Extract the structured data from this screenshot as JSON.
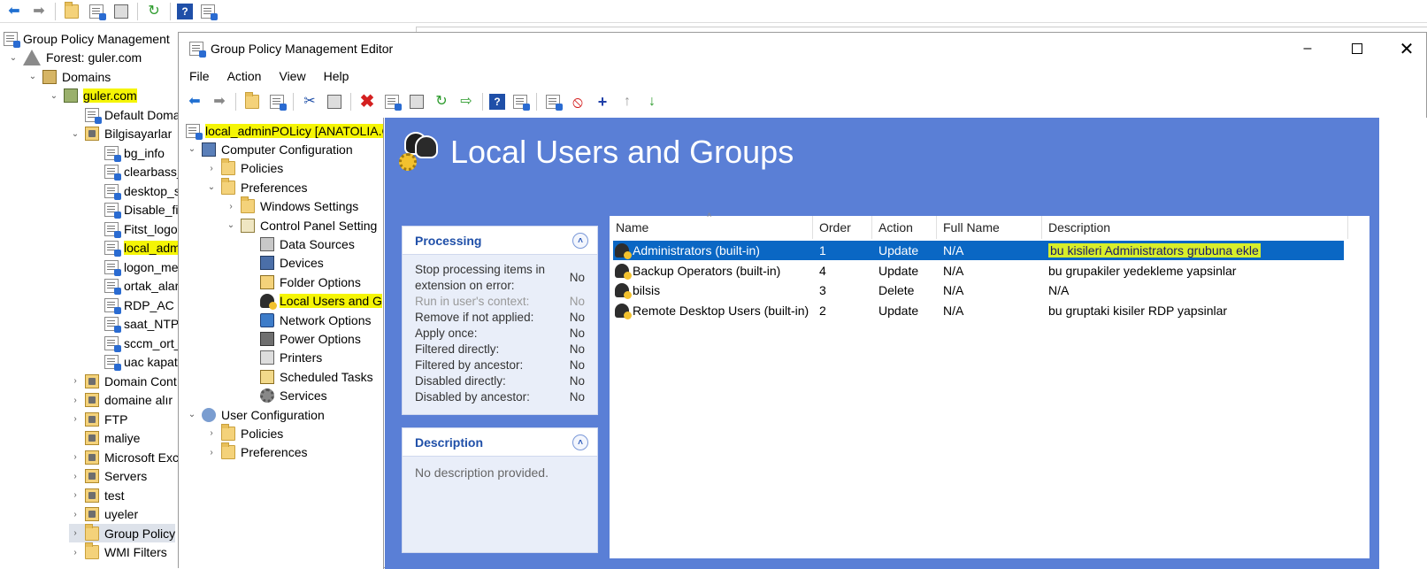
{
  "outer": {
    "tree": [
      {
        "label": "Group Policy Management",
        "icon": "gpm-icon",
        "indent": 0
      },
      {
        "label": "Forest: guler.com",
        "icon": "forest-icon",
        "indent": 1
      },
      {
        "label": "Domains",
        "icon": "domains-icon",
        "indent": 2
      },
      {
        "label": "guler.com",
        "icon": "domain-icon",
        "indent": 3
      },
      {
        "label": "Default Doma",
        "icon": "gpo-icon",
        "indent": 4
      },
      {
        "label": "Bilgisayarlar",
        "icon": "ou-icon",
        "indent": 4
      },
      {
        "label": "bg_info",
        "icon": "gpo-icon",
        "indent": 5
      },
      {
        "label": "clearbass_",
        "icon": "gpo-icon",
        "indent": 5
      },
      {
        "label": "desktop_s",
        "icon": "gpo-icon",
        "indent": 5
      },
      {
        "label": "Disable_fi",
        "icon": "gpo-icon",
        "indent": 5
      },
      {
        "label": "Fitst_logo",
        "icon": "gpo-icon",
        "indent": 5
      },
      {
        "label": "local_adm",
        "icon": "gpo-icon",
        "indent": 5
      },
      {
        "label": "logon_me",
        "icon": "gpo-icon",
        "indent": 5
      },
      {
        "label": "ortak_alar",
        "icon": "gpo-icon",
        "indent": 5
      },
      {
        "label": "RDP_AC",
        "icon": "gpo-icon",
        "indent": 5
      },
      {
        "label": "saat_NTP",
        "icon": "gpo-icon",
        "indent": 5
      },
      {
        "label": "sccm_ort_",
        "icon": "gpo-icon",
        "indent": 5
      },
      {
        "label": "uac kapat",
        "icon": "gpo-icon",
        "indent": 5
      },
      {
        "label": "Domain Cont",
        "icon": "ou-icon",
        "indent": 4
      },
      {
        "label": "domaine alır",
        "icon": "ou-icon",
        "indent": 4
      },
      {
        "label": "FTP",
        "icon": "ou-icon",
        "indent": 4
      },
      {
        "label": "maliye",
        "icon": "ou-icon",
        "indent": 4
      },
      {
        "label": "Microsoft Exc",
        "icon": "ou-icon",
        "indent": 4
      },
      {
        "label": "Servers",
        "icon": "ou-icon",
        "indent": 4
      },
      {
        "label": "test",
        "icon": "ou-icon",
        "indent": 4
      },
      {
        "label": "uyeler",
        "icon": "ou-icon",
        "indent": 4
      },
      {
        "label": "Group Policy",
        "icon": "folder-icon",
        "indent": 4
      },
      {
        "label": "WMI Filters",
        "icon": "folder-icon",
        "indent": 4
      }
    ]
  },
  "editor": {
    "title": "Group Policy Management Editor",
    "menu": [
      "File",
      "Action",
      "View",
      "Help"
    ],
    "tree": [
      {
        "label": "local_adminPOLicy [ANATOLIA.GU",
        "icon": "gpo-icon"
      },
      {
        "label": "Computer Configuration",
        "icon": "computer-icon"
      },
      {
        "label": "Policies",
        "icon": "folder-icon"
      },
      {
        "label": "Preferences",
        "icon": "folder-icon"
      },
      {
        "label": "Windows Settings",
        "icon": "folder-icon"
      },
      {
        "label": "Control Panel Setting",
        "icon": "control-panel-icon"
      },
      {
        "label": "Data Sources",
        "icon": "data-sources-icon"
      },
      {
        "label": "Devices",
        "icon": "devices-icon"
      },
      {
        "label": "Folder Options",
        "icon": "folder-options-icon"
      },
      {
        "label": "Local Users and G",
        "icon": "local-users-icon"
      },
      {
        "label": "Network Options",
        "icon": "network-icon"
      },
      {
        "label": "Power Options",
        "icon": "power-icon"
      },
      {
        "label": "Printers",
        "icon": "printer-icon"
      },
      {
        "label": "Scheduled Tasks",
        "icon": "tasks-icon"
      },
      {
        "label": "Services",
        "icon": "services-icon"
      },
      {
        "label": "User Configuration",
        "icon": "user-icon"
      },
      {
        "label": "Policies",
        "icon": "folder-icon"
      },
      {
        "label": "Preferences",
        "icon": "folder-icon"
      }
    ],
    "header": "Local Users and Groups",
    "processing": {
      "title": "Processing",
      "rows": [
        {
          "label": "Stop processing items in extension on error:",
          "value": "No",
          "dim": false
        },
        {
          "label": "Run in user's context:",
          "value": "No",
          "dim": true
        },
        {
          "label": "Remove if not applied:",
          "value": "No",
          "dim": false
        },
        {
          "label": "Apply once:",
          "value": "No",
          "dim": false
        },
        {
          "label": "Filtered directly:",
          "value": "No",
          "dim": false
        },
        {
          "label": "Filtered by ancestor:",
          "value": "No",
          "dim": false
        },
        {
          "label": "Disabled directly:",
          "value": "No",
          "dim": false
        },
        {
          "label": "Disabled by ancestor:",
          "value": "No",
          "dim": false
        }
      ]
    },
    "description": {
      "title": "Description",
      "text": "No description provided."
    },
    "list": {
      "columns": [
        "Name",
        "Order",
        "Action",
        "Full Name",
        "Description"
      ],
      "rows": [
        {
          "name": "Administrators (built-in)",
          "order": "1",
          "action": "Update",
          "fullname": "N/A",
          "description": "bu kisileri Administrators grubuna ekle",
          "selected": true
        },
        {
          "name": "Backup Operators (built-in)",
          "order": "4",
          "action": "Update",
          "fullname": "N/A",
          "description": "bu grupakiler yedekleme yapsinlar",
          "selected": false
        },
        {
          "name": "bilsis",
          "order": "3",
          "action": "Delete",
          "fullname": "N/A",
          "description": "N/A",
          "selected": false
        },
        {
          "name": "Remote Desktop Users (built-in)",
          "order": "2",
          "action": "Update",
          "fullname": "N/A",
          "description": "bu gruptaki kisiler RDP yapsinlar",
          "selected": false
        }
      ]
    }
  },
  "colors": {
    "highlight": "#f5f505",
    "selection": "#0a67c4",
    "panel_bg": "#5a7fd6"
  }
}
